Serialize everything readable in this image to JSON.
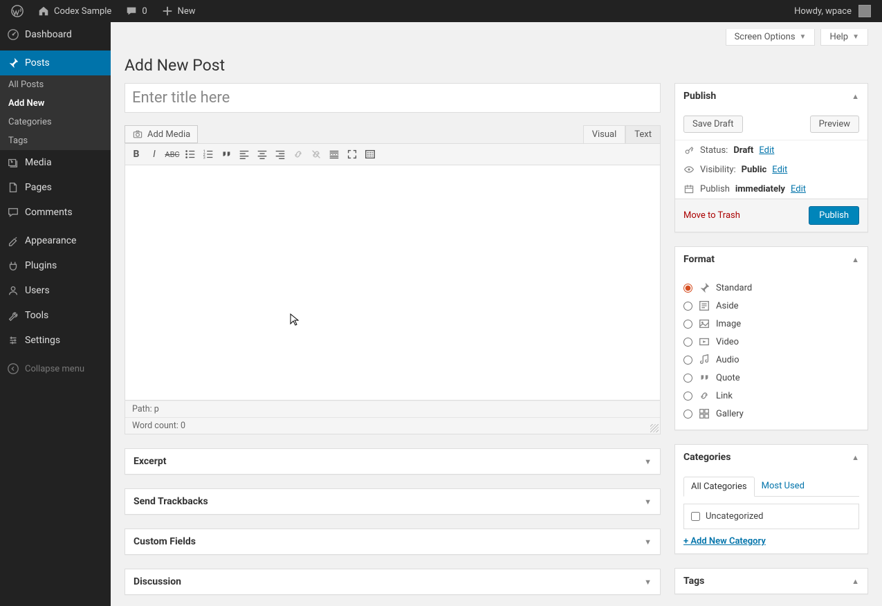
{
  "adminbar": {
    "site_name": "Codex Sample",
    "comments_count": "0",
    "new_label": "New",
    "howdy": "Howdy, wpace"
  },
  "sidebar": {
    "dashboard": "Dashboard",
    "posts": "Posts",
    "posts_sub": {
      "all": "All Posts",
      "add": "Add New",
      "cats": "Categories",
      "tags": "Tags"
    },
    "media": "Media",
    "pages": "Pages",
    "comments": "Comments",
    "appearance": "Appearance",
    "plugins": "Plugins",
    "users": "Users",
    "tools": "Tools",
    "settings": "Settings",
    "collapse": "Collapse menu"
  },
  "top": {
    "screen_options": "Screen Options",
    "help": "Help"
  },
  "page_title": "Add New Post",
  "title_placeholder": "Enter title here",
  "editor": {
    "add_media": "Add Media",
    "tab_visual": "Visual",
    "tab_text": "Text",
    "path_label": "Path:",
    "path_value": "p",
    "wordcount": "Word count: 0"
  },
  "metaboxes": {
    "excerpt": "Excerpt",
    "trackbacks": "Send Trackbacks",
    "custom_fields": "Custom Fields",
    "discussion": "Discussion"
  },
  "publish": {
    "title": "Publish",
    "save_draft": "Save Draft",
    "preview": "Preview",
    "status_label": "Status:",
    "status_value": "Draft",
    "edit": "Edit",
    "visibility_label": "Visibility:",
    "visibility_value": "Public",
    "publish_label": "Publish",
    "publish_value": "immediately",
    "trash": "Move to Trash",
    "publish_btn": "Publish"
  },
  "format": {
    "title": "Format",
    "options": [
      "Standard",
      "Aside",
      "Image",
      "Video",
      "Audio",
      "Quote",
      "Link",
      "Gallery"
    ]
  },
  "categories": {
    "title": "Categories",
    "tab_all": "All Categories",
    "tab_most": "Most Used",
    "uncategorized": "Uncategorized",
    "add_new": "+ Add New Category"
  },
  "tags": {
    "title": "Tags"
  }
}
